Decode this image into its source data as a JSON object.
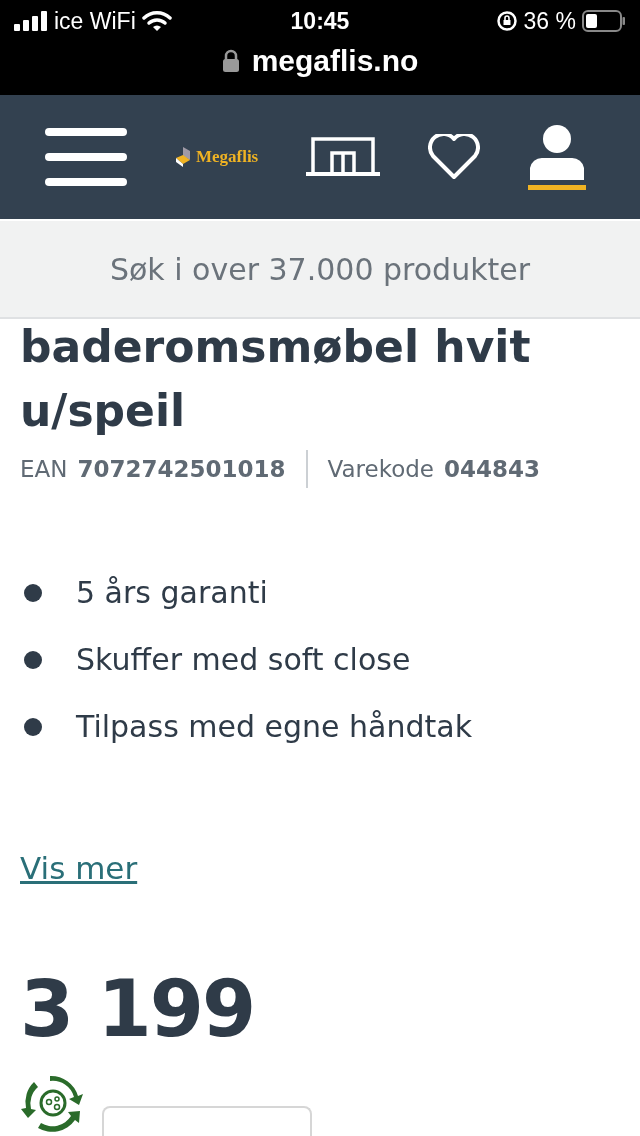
{
  "status_bar": {
    "carrier": "ice WiFi",
    "time": "10:45",
    "battery": "36 %",
    "url": "megaflis.no"
  },
  "header": {
    "logo": "Megaflis"
  },
  "search": {
    "placeholder": "Søk i over 37.000 produkter"
  },
  "product": {
    "title": "baderomsmøbel hvit u/speil",
    "ean_label": "EAN",
    "ean": "7072742501018",
    "code_label": "Varekode",
    "code": "044843",
    "features": [
      "5 års garanti",
      "Skuffer med soft close",
      "Tilpass med egne håndtak"
    ],
    "more_link": "Vis mer",
    "price": "3 199"
  }
}
